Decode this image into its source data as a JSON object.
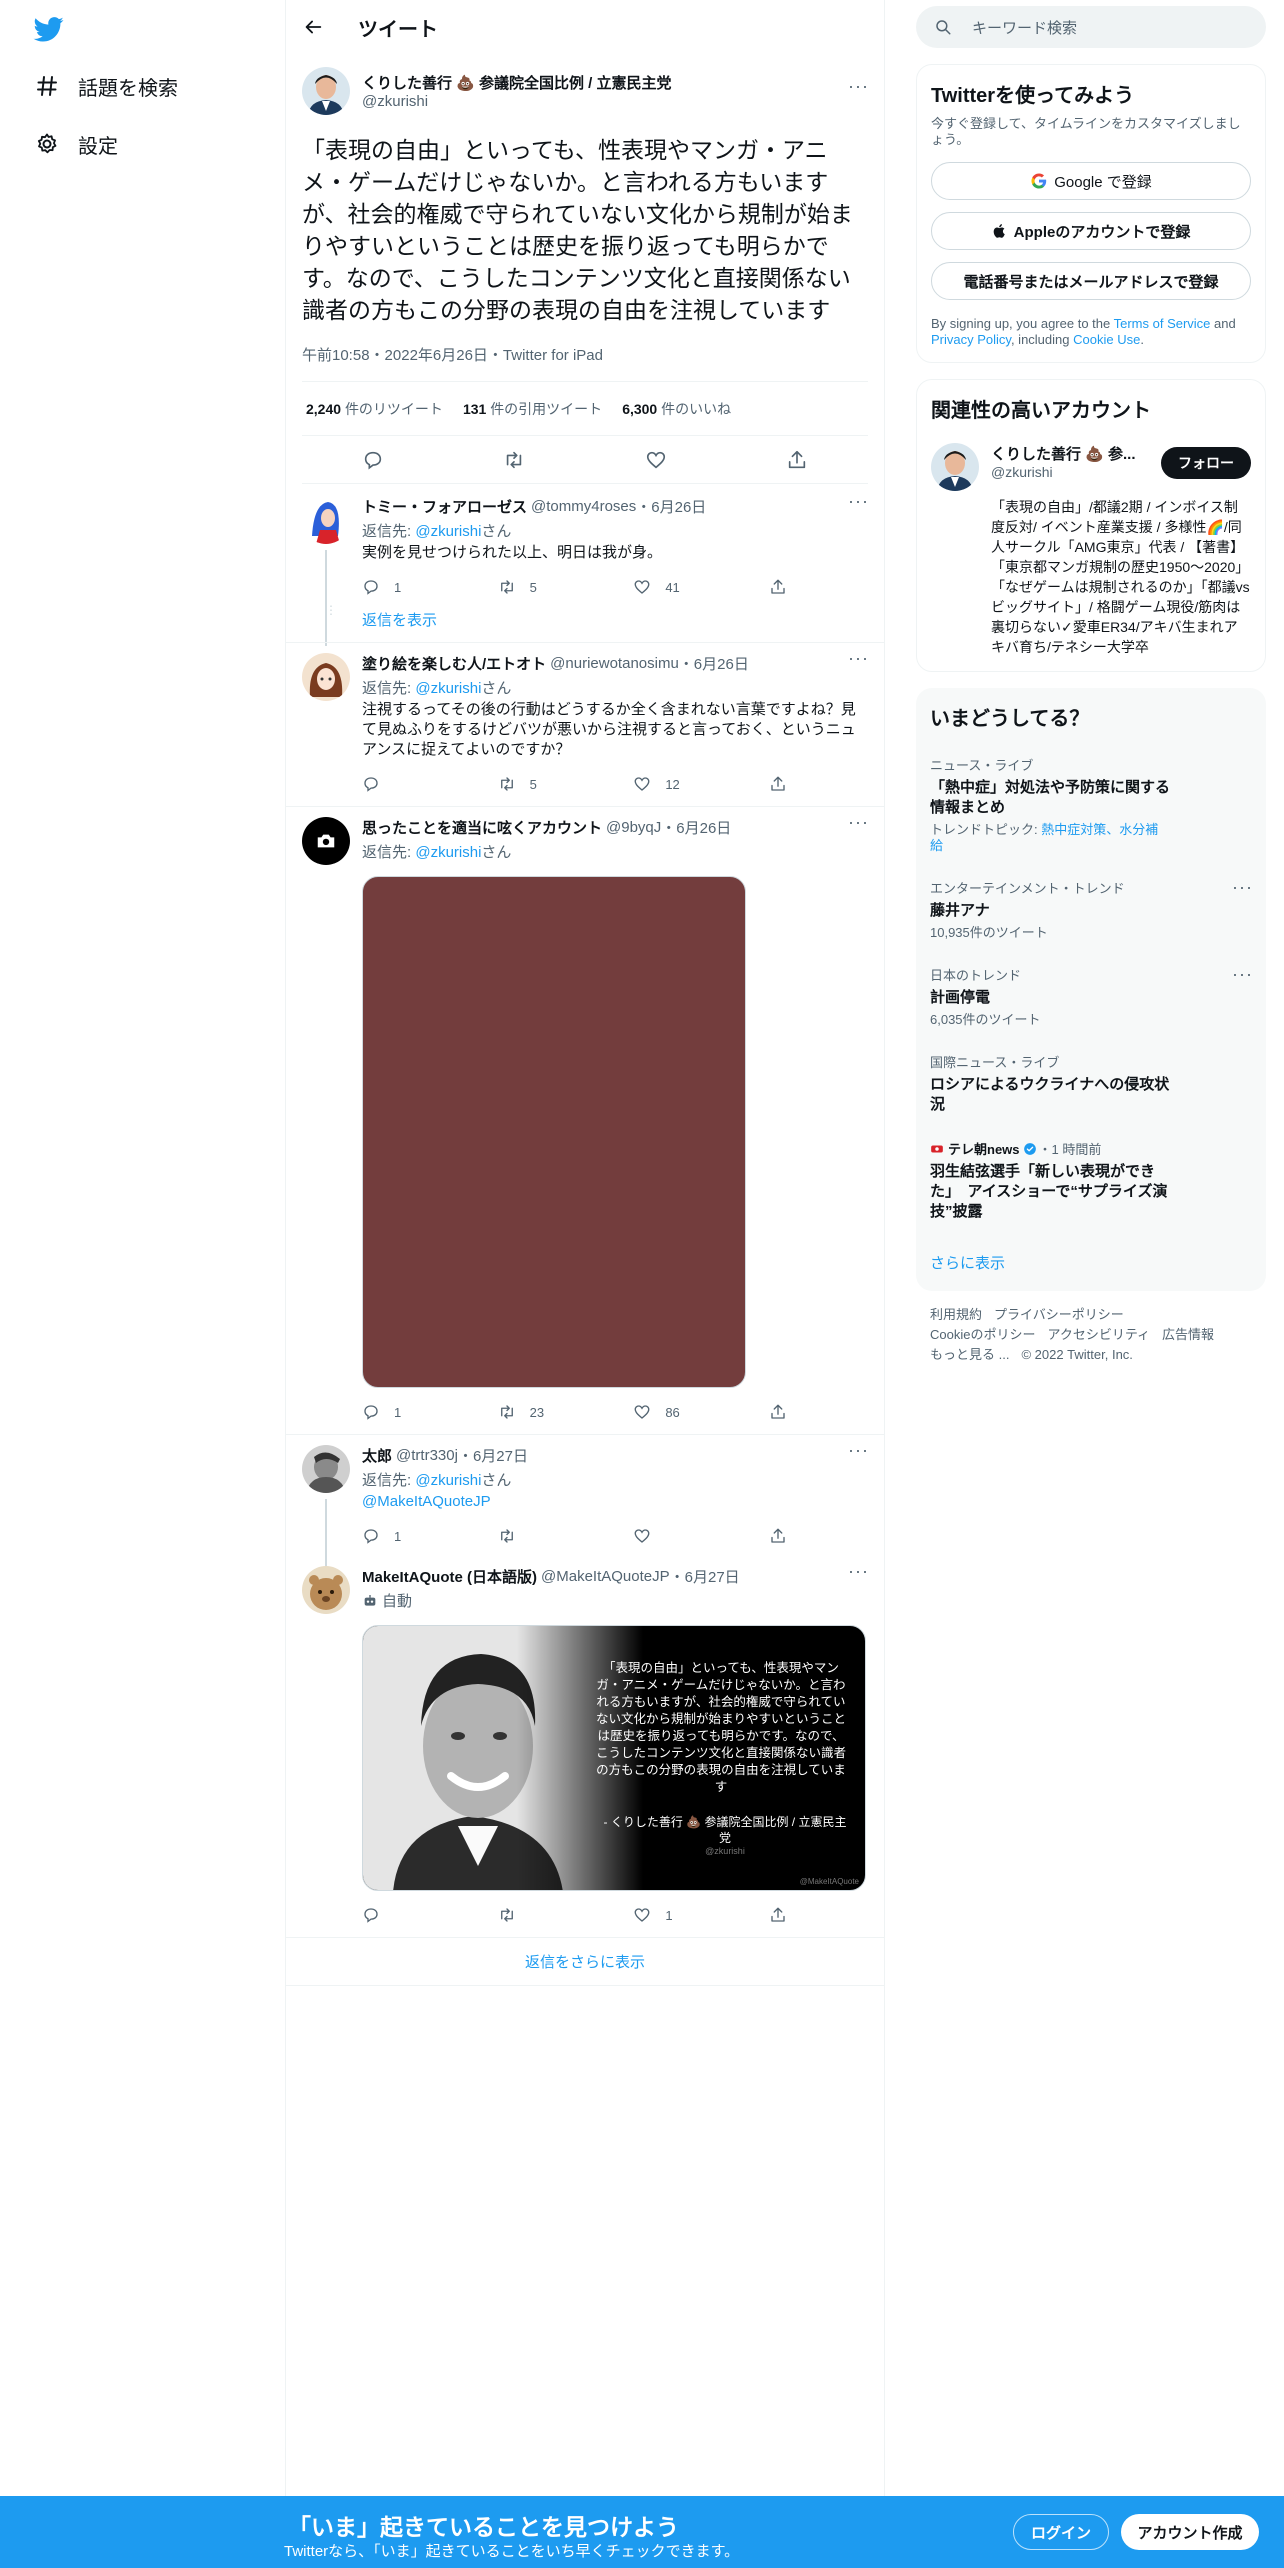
{
  "nav": {
    "explore_label": "話題を検索",
    "settings_label": "設定"
  },
  "header": {
    "title": "ツイート"
  },
  "main_tweet": {
    "name": "くりした善行 💩 参議院全国比例 / 立憲民主党",
    "handle": "@zkurishi",
    "text": "「表現の自由」といっても、性表現やマンガ・アニメ・ゲームだけじゃないか。と言われる方もいますが、社会的権威で守られていない文化から規制が始まりやすいということは歴史を振り返っても明らかです。なので、こうしたコンテンツ文化と直接関係ない識者の方もこの分野の表現の自由を注視しています",
    "meta": "午前10:58・2022年6月26日・Twitter for iPad",
    "retweets_count": "2,240",
    "retweets_label": "件のリツイート",
    "quotes_count": "131",
    "quotes_label": "件の引用ツイート",
    "likes_count": "6,300",
    "likes_label": "件のいいね"
  },
  "replies": [
    {
      "name": "トミー・フォアローゼス",
      "handle": "@tommy4roses",
      "date": "・6月26日",
      "replyto_prefix": "返信先: ",
      "replyto_handle": "@zkurishi",
      "replyto_suffix": "さん",
      "text": "実例を見せつけられた以上、明日は我が身。",
      "reply_count": "1",
      "retweet_count": "5",
      "like_count": "41",
      "show_replies": "返信を表示"
    },
    {
      "name": "塗り絵を楽しむ人/エトオト",
      "handle": "@nuriewotanosimu",
      "date": "・6月26日",
      "replyto_prefix": "返信先: ",
      "replyto_handle": "@zkurishi",
      "replyto_suffix": "さん",
      "text": "注視するってその後の行動はどうするか全く含まれない言葉ですよね？見て見ぬふりをするけどバツが悪いから注視すると言っておく、というニュアンスに捉えてよいのですか？",
      "reply_count": "",
      "retweet_count": "5",
      "like_count": "12"
    },
    {
      "name": "思ったことを適当に呟くアカウント",
      "handle": "@9byqJ",
      "date": "・6月26日",
      "replyto_prefix": "返信先: ",
      "replyto_handle": "@zkurishi",
      "replyto_suffix": "さん",
      "image_color": "#733d3d",
      "reply_count": "1",
      "retweet_count": "23",
      "like_count": "86"
    },
    {
      "name": "太郎",
      "handle": "@trtr330j",
      "date": "・6月27日",
      "replyto_prefix": "返信先: ",
      "replyto_handle": "@zkurishi",
      "replyto_suffix": "さん",
      "mention": "@MakeItAQuoteJP",
      "reply_count": "1",
      "retweet_count": "",
      "like_count": ""
    },
    {
      "name": "MakeItAQuote (日本語版)",
      "handle": "@MakeItAQuoteJP",
      "date": "・6月27日",
      "auto_label": "自動",
      "quote_text": "「表現の自由」といっても、性表現やマンガ・アニメ・ゲームだけじゃないか。と言われる方もいますが、社会的権威で守られていない文化から規制が始まりやすいということは歴史を振り返っても明らかです。なので、こうしたコンテンツ文化と直接関係ない識者の方もこの分野の表現の自由を注視しています",
      "quote_author": "- くりした善行 💩 参議院全国比例 / 立憲民主党",
      "quote_handle": "@zkurishi",
      "quote_watermark": "@MakeItAQuote",
      "reply_count": "",
      "retweet_count": "",
      "like_count": "1"
    }
  ],
  "show_more_replies": "返信をさらに表示",
  "right": {
    "search_placeholder": "キーワード検索",
    "signup_box": {
      "title": "Twitterを使ってみよう",
      "subtitle": "今すぐ登録して、タイムラインをカスタマイズしましょう。",
      "google": "Google で登録",
      "apple": "Appleのアカウントで登録",
      "phone": "電話番号またはメールアドレスで登録",
      "terms_1": "By signing up, you agree to the ",
      "terms_tos": "Terms of Service",
      "terms_2": " and ",
      "terms_privacy": "Privacy Policy",
      "terms_3": ", including ",
      "terms_cookie": "Cookie Use",
      "terms_4": "."
    },
    "relevant": {
      "title": "関連性の高いアカウント",
      "name": "くりした善行 💩 参...",
      "handle": "@zkurishi",
      "follow": "フォロー",
      "bio": "「表現の自由」/都議2期 / インボイス制度反対/ イベント産業支援 / 多様性🌈/同人サークル「AMG東京」代表 / 【著書】「東京都マンガ規制の歴史1950〜2020」「なぜゲームは規制されるのか」「都議vsビッグサイト」/ 格闘ゲーム現役/筋肉は裏切らない✓愛車ER34/アキバ生まれアキバ育ち/テネシー大学卒"
    },
    "trends": {
      "title": "いまどうしてる？",
      "items": [
        {
          "category": "ニュース・ライブ",
          "title": "「熱中症」対処法や予防策に関する情報まとめ",
          "extra_prefix": "トレンドトピック: ",
          "extra": "熱中症対策、水分補給"
        },
        {
          "category": "エンターテインメント・トレンド",
          "title": "藤井アナ",
          "extra_prefix": "",
          "extra": "10,935件のツイート"
        },
        {
          "category": "日本のトレンド",
          "title": "計画停電",
          "extra_prefix": "",
          "extra": "6,035件のツイート"
        },
        {
          "category": "国際ニュース・ライブ",
          "title": "ロシアによるウクライナへの侵攻状況",
          "extra_prefix": "",
          "extra": ""
        },
        {
          "category": "テレ朝news",
          "category_suffix": "・1 時間前",
          "title": "羽生結弦選手「新しい表現ができた」　アイスショーで“サプライズ演技”披露",
          "extra_prefix": "",
          "extra": ""
        }
      ],
      "show_more": "さらに表示"
    },
    "footer": {
      "terms": "利用規約",
      "privacy": "プライバシーポリシー",
      "cookie": "Cookieのポリシー",
      "accessibility": "アクセシビリティ",
      "ads": "広告情報",
      "more": "もっと見る ...",
      "copyright": "© 2022 Twitter, Inc."
    }
  },
  "bottom_bar": {
    "title": "「いま」起きていることを見つけよう",
    "subtitle": "Twitterなら、「いま」起きていることをいち早くチェックできます。",
    "login": "ログイン",
    "signup": "アカウント作成"
  },
  "colors": {
    "accent": "#1d9bf0",
    "text": "#0f1419",
    "muted": "#536471"
  }
}
